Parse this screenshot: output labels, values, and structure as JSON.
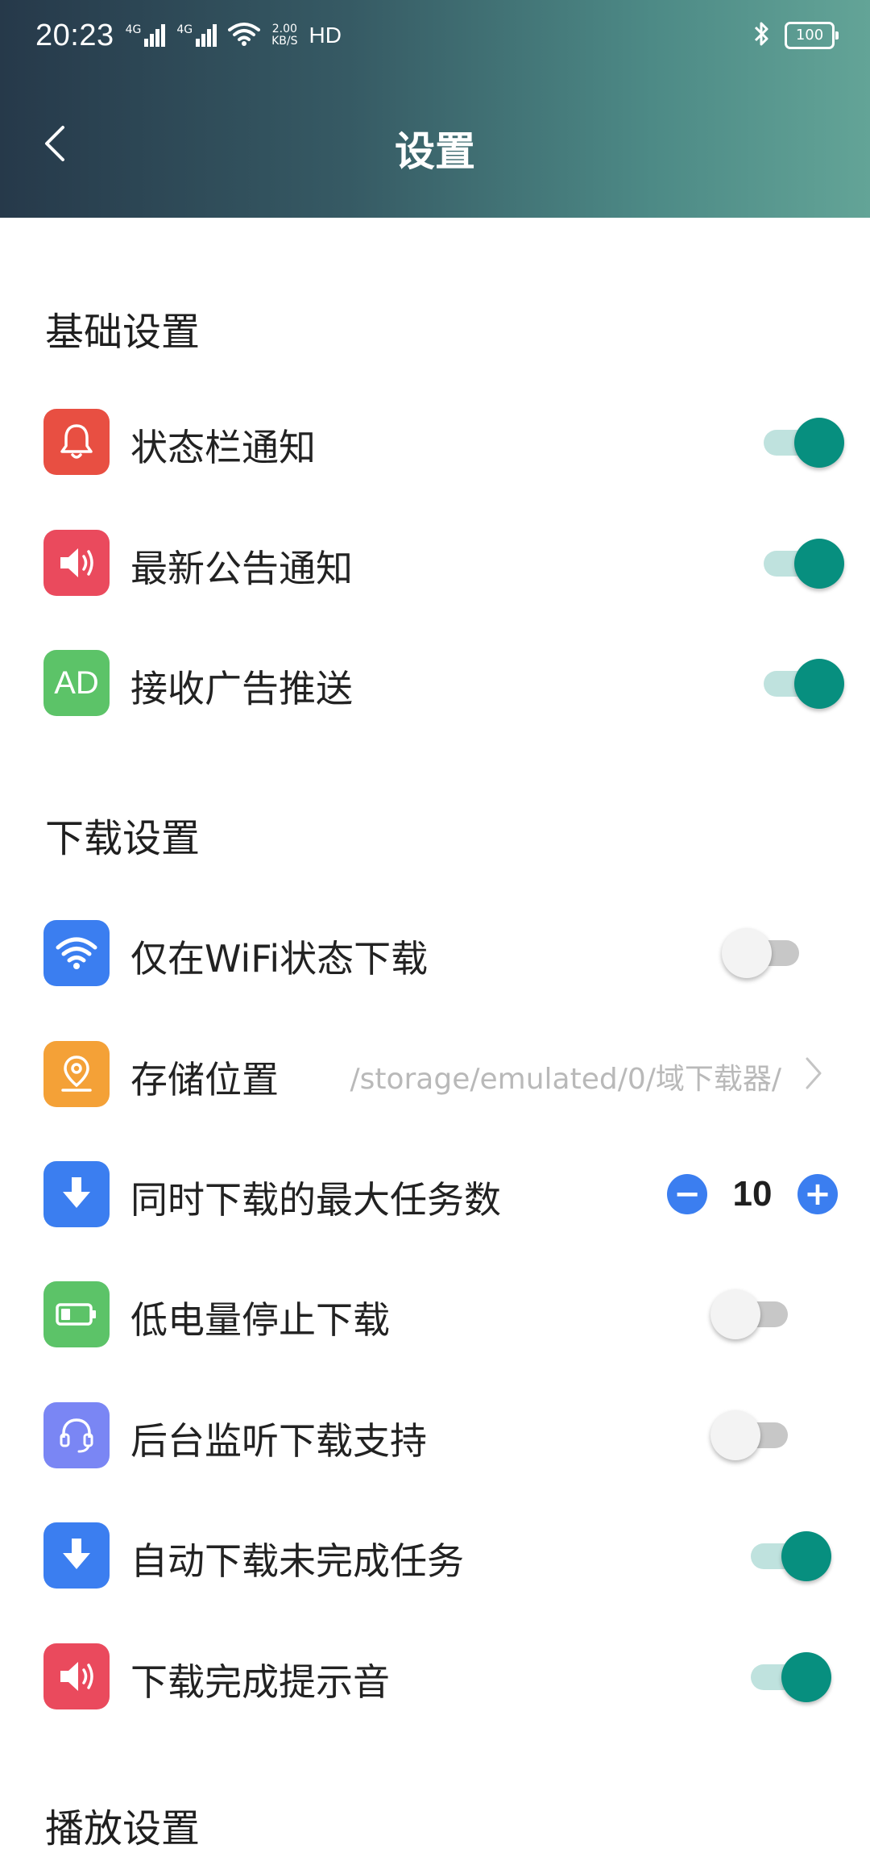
{
  "status_bar": {
    "time": "20:23",
    "network_1": "4G",
    "network_2": "4G",
    "speed_value": "2.00",
    "speed_unit": "KB/S",
    "hd": "HD",
    "battery": "100"
  },
  "header": {
    "title": "设置"
  },
  "sections": {
    "basic": {
      "title": "基础设置",
      "items": [
        {
          "label": "状态栏通知",
          "icon": "bell-icon",
          "color": "#e84f42",
          "state": "on"
        },
        {
          "label": "最新公告通知",
          "icon": "speaker-icon",
          "color": "#ea4a5d",
          "state": "on"
        },
        {
          "label": "接收广告推送",
          "icon_text": "AD",
          "icon": "ad-icon",
          "color": "#5cc368",
          "state": "on"
        }
      ]
    },
    "download": {
      "title": "下载设置",
      "items": [
        {
          "label": "仅在WiFi状态下载",
          "icon": "wifi-icon",
          "color": "#3b7ef0",
          "state": "off"
        },
        {
          "label": "存储位置",
          "icon": "location-icon",
          "color": "#f4a137",
          "value": "/storage/emulated/0/域下载器/"
        },
        {
          "label": "同时下载的最大任务数",
          "icon": "download-icon",
          "color": "#3b7ef0",
          "value": "10",
          "minus": "−",
          "plus": "+"
        },
        {
          "label": "低电量停止下载",
          "icon": "battery-icon",
          "color": "#5cc368",
          "state": "off"
        },
        {
          "label": "后台监听下载支持",
          "icon": "headset-icon",
          "color": "#7a86f4",
          "state": "off"
        },
        {
          "label": "自动下载未完成任务",
          "icon": "download-icon",
          "color": "#3b7ef0",
          "state": "on"
        },
        {
          "label": "下载完成提示音",
          "icon": "speaker-icon",
          "color": "#ea4a5d",
          "state": "on"
        }
      ]
    },
    "play": {
      "title": "播放设置"
    }
  },
  "colors": {
    "toggle_on": "#078f7f",
    "toggle_on_track": "#bfe2de",
    "toggle_off_track": "#c7c7c7",
    "accent_blue": "#3b7ef0"
  }
}
